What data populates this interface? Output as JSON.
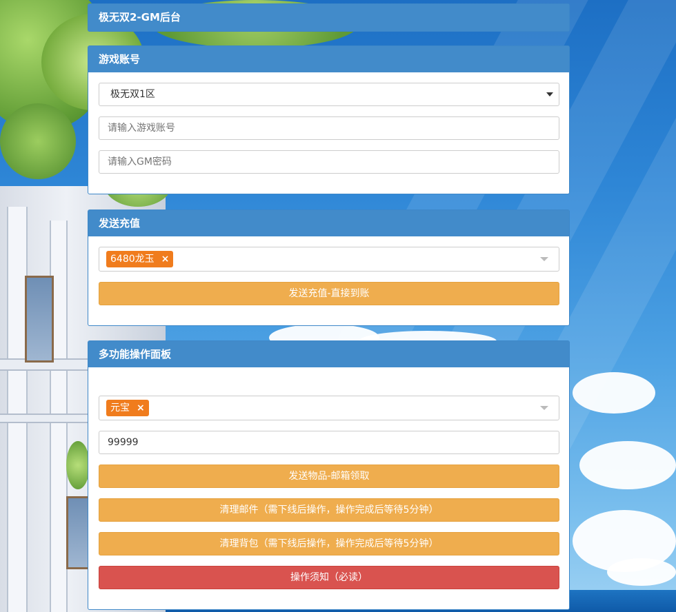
{
  "header": {
    "title": "极无双2-GM后台"
  },
  "account_panel": {
    "title": "游戏账号",
    "server_select": {
      "value": "极无双1区"
    },
    "account_input": {
      "value": "",
      "placeholder": "请输入游戏账号"
    },
    "password_input": {
      "value": "",
      "placeholder": "请输入GM密码"
    }
  },
  "recharge_panel": {
    "title": "发送充值",
    "selected_tag": "6480龙玉",
    "tag_remove": "×",
    "send_button": "发送充值-直接到账"
  },
  "multi_panel": {
    "title": "多功能操作面板",
    "selected_tag": "元宝",
    "tag_remove": "×",
    "quantity_input": {
      "value": "99999"
    },
    "buttons": [
      "发送物品-邮箱领取",
      "清理邮件（需下线后操作，操作完成后等待5分钟）",
      "清理背包（需下线后操作，操作完成后等待5分钟）",
      "操作须知（必读）"
    ]
  },
  "colors": {
    "panel_header": "#428bca",
    "warning_button": "#efad4e",
    "danger_button": "#d9534f",
    "tag": "#f07c1d"
  }
}
